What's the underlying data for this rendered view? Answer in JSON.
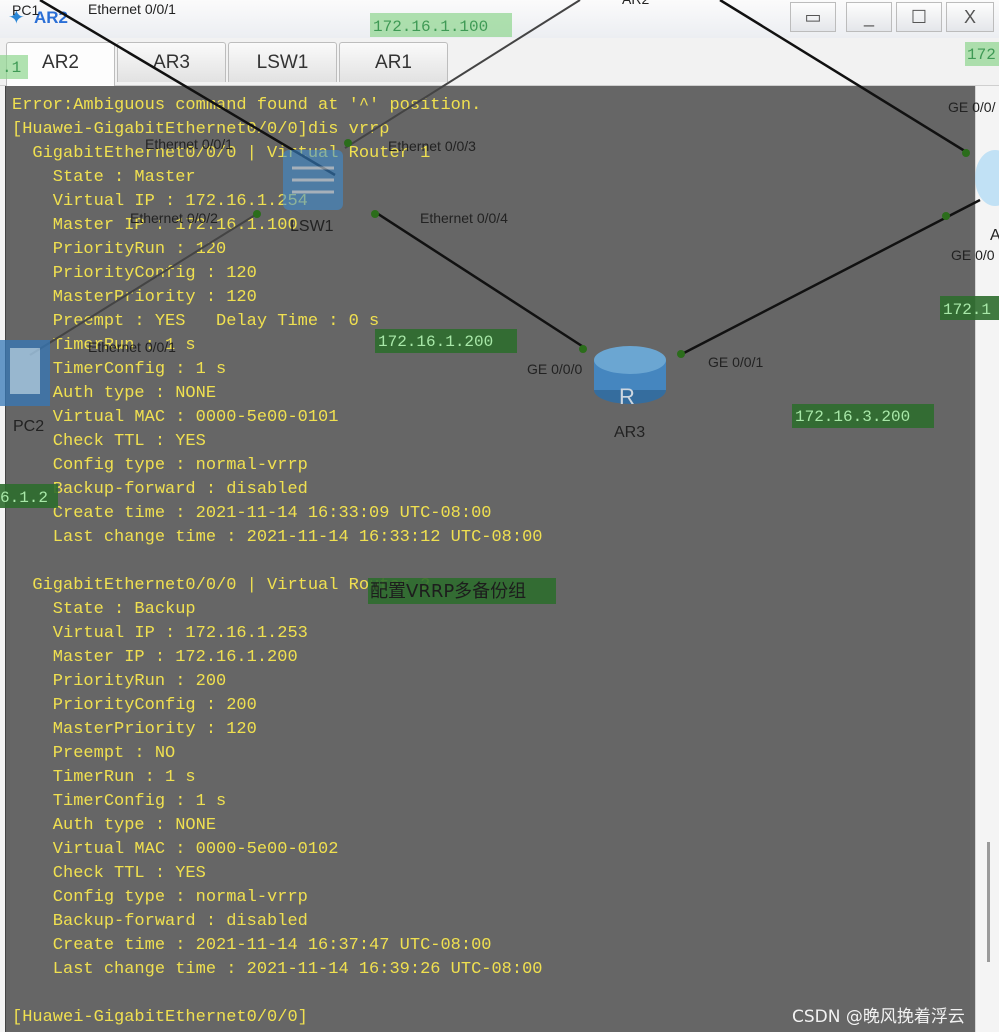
{
  "window": {
    "title": "AR2",
    "controls": {
      "restore": "▭",
      "minimize": "_",
      "maximize": "☐",
      "close": "X"
    }
  },
  "tabs": [
    {
      "label": "AR2",
      "active": true
    },
    {
      "label": "AR3",
      "active": false
    },
    {
      "label": "LSW1",
      "active": false
    },
    {
      "label": "AR1",
      "active": false
    }
  ],
  "terminal": {
    "text_color": "#f0e050",
    "background": "#666666",
    "lines": [
      "Error:Ambiguous command found at '^' position.",
      "[Huawei-GigabitEthernet0/0/0]dis vrrp",
      "  GigabitEthernet0/0/0 | Virtual Router 1",
      "    State : Master",
      "    Virtual IP : 172.16.1.254",
      "    Master IP : 172.16.1.100",
      "    PriorityRun : 120",
      "    PriorityConfig : 120",
      "    MasterPriority : 120",
      "    Preempt : YES   Delay Time : 0 s",
      "    TimerRun : 1 s",
      "    TimerConfig : 1 s",
      "    Auth type : NONE",
      "    Virtual MAC : 0000-5e00-0101",
      "    Check TTL : YES",
      "    Config type : normal-vrrp",
      "    Backup-forward : disabled",
      "    Create time : 2021-11-14 16:33:09 UTC-08:00",
      "    Last change time : 2021-11-14 16:33:12 UTC-08:00",
      "",
      "  GigabitEthernet0/0/0 | Virtual Router 2",
      "    State : Backup",
      "    Virtual IP : 172.16.1.253",
      "    Master IP : 172.16.1.200",
      "    PriorityRun : 200",
      "    PriorityConfig : 200",
      "    MasterPriority : 120",
      "    Preempt : NO",
      "    TimerRun : 1 s",
      "    TimerConfig : 1 s",
      "    Auth type : NONE",
      "    Virtual MAC : 0000-5e00-0102",
      "    Check TTL : YES",
      "    Config type : normal-vrrp",
      "    Backup-forward : disabled",
      "    Create time : 2021-11-14 16:37:47 UTC-08:00",
      "    Last change time : 2021-11-14 16:39:26 UTC-08:00",
      "",
      "[Huawei-GigabitEthernet0/0/0]"
    ]
  },
  "topology": {
    "devices": {
      "lsw1": "LSW1",
      "ar3": "AR3",
      "pc2": "PC2",
      "pc1": "PC1",
      "ar2_top": "AR2",
      "ar1_partial": "A"
    },
    "port_labels": {
      "pc1_eth": "Ethernet 0/0/1",
      "lsw_e1": "Ethernet 0/0/1",
      "lsw_e3": "Ethernet 0/0/3",
      "lsw_e2": "Ethernet 0/0/2",
      "lsw_e4": "Ethernet 0/0/4",
      "pc2_eth": "Ethernet 0/0/1",
      "ar3_ge0": "GE 0/0/0",
      "ar3_ge1": "GE 0/0/1",
      "ar1_ge_top": "GE 0/0/",
      "ar1_ge_bottom": "GE 0/0"
    },
    "ip_labels": {
      "ar2_ip": "172.16.1.100",
      "ar3_ip": "172.16.1.200",
      "ar3_wan_ip": "172.16.3.200",
      "right_top_ip": "172",
      "right_mid_ip": "172.1",
      "left_top_ip": ".1",
      "left_mid_ip": "6.1.2"
    },
    "note": "配置VRRP多备份组"
  },
  "watermark": "CSDN @晚风挽着浮云"
}
